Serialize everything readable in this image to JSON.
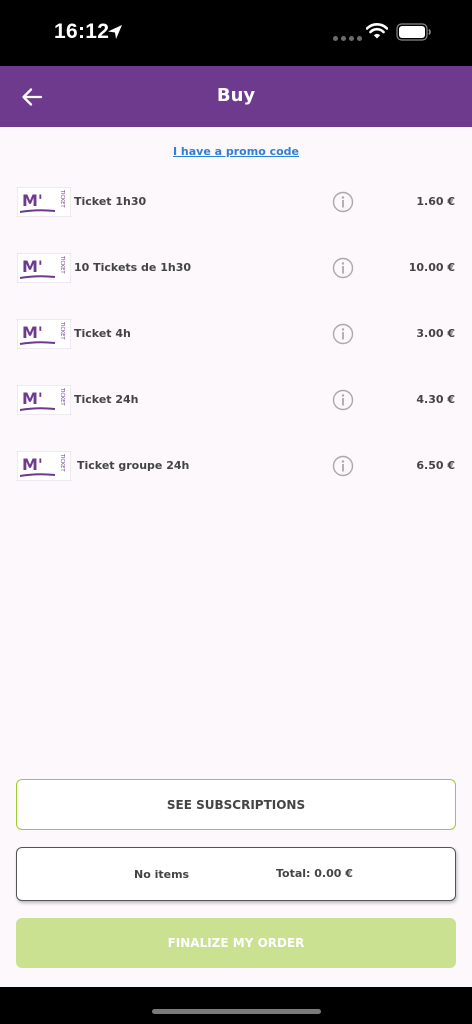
{
  "status_bar": {
    "time": "16:12",
    "icons": [
      "location-arrow-icon",
      "cellular-dots-icon",
      "wifi-icon",
      "battery-icon"
    ]
  },
  "app_bar": {
    "title": "Buy",
    "back_icon": "arrow-left-icon",
    "color": "#6e3a8e"
  },
  "promo": {
    "label": "I have a promo code",
    "color": "#2f7fd6"
  },
  "tickets": [
    {
      "name": "Ticket 1h30",
      "price": "1.60 €",
      "logo_text": "M'",
      "logo_side_text": "TICKET"
    },
    {
      "name": "10 Tickets de 1h30",
      "price": "10.00 €",
      "logo_text": "M'",
      "logo_side_text": "TICKET"
    },
    {
      "name": "Ticket 4h",
      "price": "3.00 €",
      "logo_text": "M'",
      "logo_side_text": "TICKET"
    },
    {
      "name": "Ticket 24h",
      "price": "4.30 €",
      "logo_text": "M'",
      "logo_side_text": "TICKET"
    },
    {
      "name": "Ticket groupe 24h",
      "price": "6.50 €",
      "logo_text": "M'",
      "logo_side_text": "TICKET"
    }
  ],
  "actions": {
    "subscriptions_label": "SEE SUBSCRIPTIONS",
    "finalize_label": "FINALIZE MY ORDER",
    "accent_green": "#9bcc2e",
    "finalize_disabled_color": "#cbe192"
  },
  "summary": {
    "items_text": "No items",
    "total_text": "Total: 0.00 €"
  }
}
